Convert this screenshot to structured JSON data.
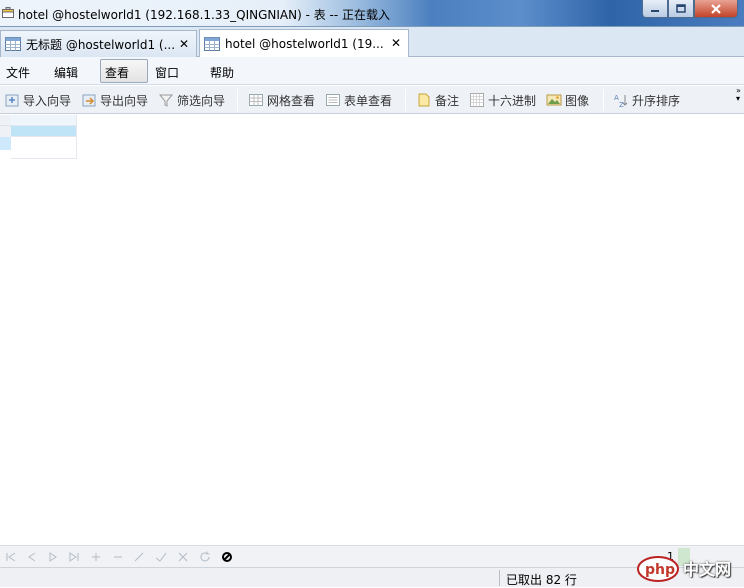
{
  "window": {
    "title": "hotel @hostelworld1 (192.168.1.33_QINGNIAN) - 表 -- 正在载入",
    "icon": "table-icon"
  },
  "tabs": [
    {
      "label": "无标题 @hostelworld1 (...",
      "icon": "table-icon",
      "close": "✕",
      "active": false
    },
    {
      "label": "hotel @hostelworld1 (19...",
      "icon": "table-icon",
      "close": "✕",
      "active": true
    }
  ],
  "menu": [
    "文件",
    "编辑",
    "查看",
    "窗口",
    "帮助"
  ],
  "toolbar": {
    "import": "导入向导",
    "export": "导出向导",
    "filter": "筛选向导",
    "grid_view": "网格查看",
    "form_view": "表单查看",
    "memo": "备注",
    "hex": "十六进制",
    "image": "图像",
    "sort": "升序排序"
  },
  "grid": {
    "selected_row_color": "#bfe3f7",
    "row_header_color": "#cde9fb"
  },
  "navigator": {
    "page": "1"
  },
  "status": {
    "rows": "已取出 82 行"
  },
  "watermark": {
    "text": "中文网",
    "logo": "php"
  }
}
